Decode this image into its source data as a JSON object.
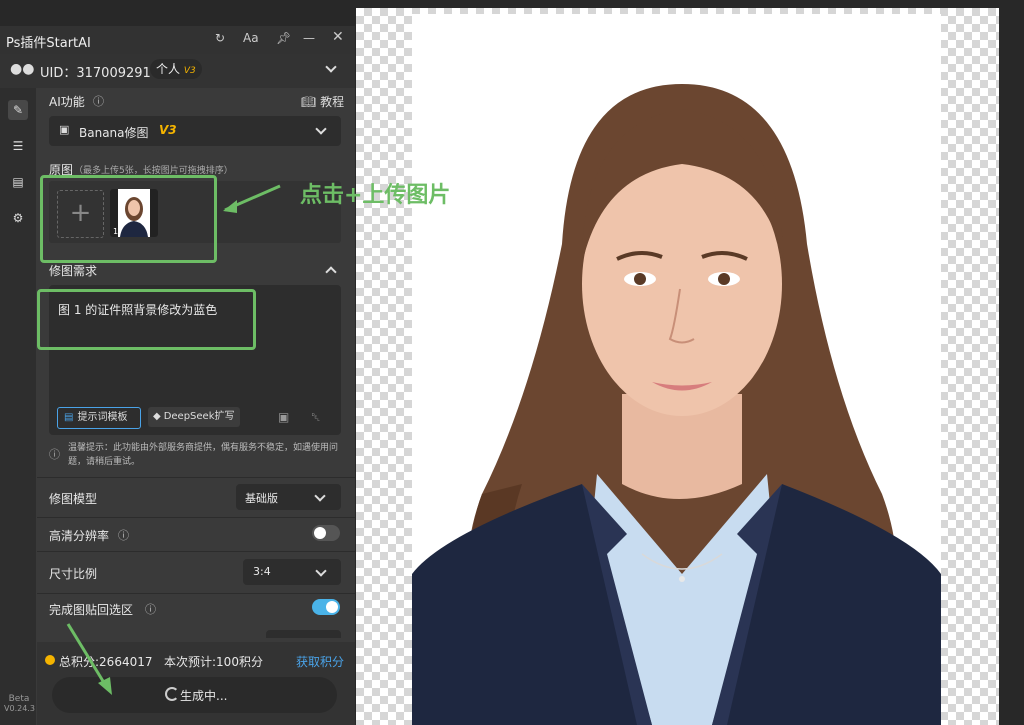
{
  "window": {
    "title": "Ps插件StartAI",
    "icons": [
      "refresh-icon",
      "font-icon",
      "pin-icon",
      "minimize-icon",
      "close-icon"
    ],
    "font_icon_label": "Aa"
  },
  "user": {
    "uid_label": "UID：317009291",
    "plan": "个人",
    "plan_version": "V3"
  },
  "ai_function": {
    "label": "AI功能",
    "tutorial": "教程",
    "selected": "Banana修图",
    "selected_version": "V3"
  },
  "source": {
    "label": "原图",
    "hint": "（最多上传5张，长按图片可拖拽排序）",
    "thumb_index": "1"
  },
  "annotation": {
    "upload_text": "点击+上传图片"
  },
  "edit": {
    "label": "修图需求",
    "prompt": "图 1 的证件照背景修改为蓝色",
    "template_button": "提示词模板",
    "deepseek_button": "DeepSeek扩写"
  },
  "notice": "温馨提示：此功能由外部服务商提供，偶有服务不稳定，如遇使用问题，请稍后重试。",
  "model": {
    "label": "修图模型",
    "value": "基础版"
  },
  "hd": {
    "label": "高清分辨率",
    "enabled": false
  },
  "ratio": {
    "label": "尺寸比例",
    "value": "3:4"
  },
  "paste_back": {
    "label": "完成图贴回选区",
    "enabled": true
  },
  "points": {
    "total_label": "总积分:2664017",
    "cost_label": "本次预计:100积分",
    "get_points": "获取积分"
  },
  "generate": {
    "label": "生成中..."
  },
  "version": {
    "beta": "Beta",
    "number": "V0.24.3"
  },
  "colors": {
    "accent": "#4ab3e8",
    "annotation_green": "#6dbd65",
    "gold": "#f5b400",
    "link": "#4aa3e8"
  }
}
